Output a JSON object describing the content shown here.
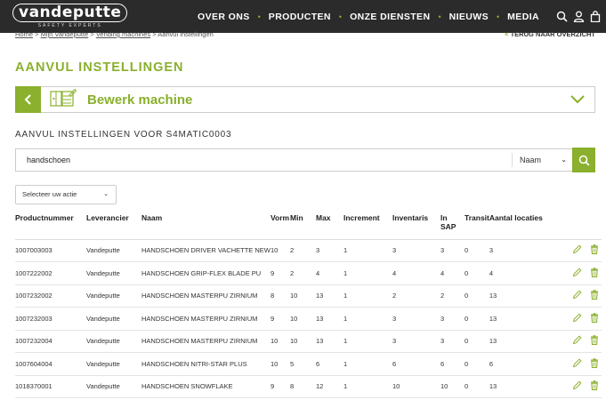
{
  "brand": {
    "name": "vandeputte",
    "tagline": "SAFETY EXPERTS",
    "accent": "#8ab02d"
  },
  "nav": {
    "items": [
      "OVER ONS",
      "PRODUCTEN",
      "ONZE DIENSTEN",
      "NIEUWS",
      "MEDIA"
    ]
  },
  "top_icons": [
    "search-icon",
    "user-icon",
    "bag-icon"
  ],
  "breadcrumb": {
    "home": "Home",
    "my": "Mijn Vandeputte",
    "vending": "Vending machines",
    "current": "Aanvul instellingen",
    "separator": ">"
  },
  "back_link": {
    "arrow": "<",
    "label": "TERUG NAAR OVERZICHT"
  },
  "page": {
    "title": "AANVUL INSTELLINGEN",
    "section_title": "AANVUL INSTELLINGEN VOOR S4MATIC0003"
  },
  "machine": {
    "label": "Bewerk machine"
  },
  "search": {
    "value": "handschoen",
    "field": "Naam"
  },
  "action": {
    "placeholder": "Selecteer uw actie"
  },
  "table": {
    "headers": [
      "Productnummer",
      "Leverancier",
      "Naam",
      "Vorm",
      "Min",
      "Max",
      "Increment",
      "Inventaris",
      "In SAP",
      "Transit",
      "Aantal locaties"
    ],
    "rows": [
      [
        "1007003003",
        "Vandeputte",
        "HANDSCHOEN DRIVER VACHETTE NEW",
        "10",
        "2",
        "3",
        "1",
        "3",
        "3",
        "0",
        "3"
      ],
      [
        "1007222002",
        "Vandeputte",
        "HANDSCHOEN GRIP-FLEX BLADE PU",
        "9",
        "2",
        "4",
        "1",
        "4",
        "4",
        "0",
        "4"
      ],
      [
        "1007232002",
        "Vandeputte",
        "HANDSCHOEN MASTERPU ZIRNIUM",
        "8",
        "10",
        "13",
        "1",
        "2",
        "2",
        "0",
        "13"
      ],
      [
        "1007232003",
        "Vandeputte",
        "HANDSCHOEN MASTERPU ZIRNIUM",
        "9",
        "10",
        "13",
        "1",
        "3",
        "3",
        "0",
        "13"
      ],
      [
        "1007232004",
        "Vandeputte",
        "HANDSCHOEN MASTERPU ZIRNIUM",
        "10",
        "10",
        "13",
        "1",
        "3",
        "3",
        "0",
        "13"
      ],
      [
        "1007604004",
        "Vandeputte",
        "HANDSCHOEN NITRI-STAR PLUS",
        "10",
        "5",
        "6",
        "1",
        "6",
        "6",
        "0",
        "6"
      ],
      [
        "1018370001",
        "Vandeputte",
        "HANDSCHOEN SNOWFLAKE",
        "9",
        "8",
        "12",
        "1",
        "10",
        "10",
        "0",
        "13"
      ]
    ],
    "row_icons": [
      "pencil-icon",
      "trash-icon"
    ]
  }
}
